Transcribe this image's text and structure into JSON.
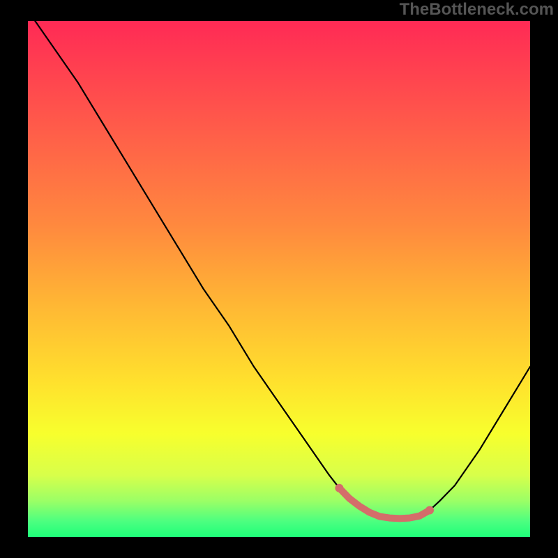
{
  "watermark": "TheBottleneck.com",
  "chart_data": {
    "type": "line",
    "title": "",
    "xlabel": "",
    "ylabel": "",
    "xlim": [
      0,
      100
    ],
    "ylim": [
      0,
      100
    ],
    "series": [
      {
        "name": "bottleneck-curve",
        "x": [
          0,
          5,
          10,
          15,
          20,
          25,
          30,
          35,
          40,
          45,
          50,
          55,
          60,
          62,
          64,
          66,
          68,
          70,
          72,
          74,
          76,
          78,
          80,
          82,
          85,
          90,
          95,
          100
        ],
        "values": [
          102,
          95,
          88,
          80,
          72,
          64,
          56,
          48,
          41,
          33,
          26,
          19,
          12,
          9.5,
          7.5,
          6,
          4.8,
          4,
          3.7,
          3.6,
          3.7,
          4.1,
          5.2,
          7,
          10,
          17,
          25,
          33
        ]
      }
    ],
    "highlight": {
      "name": "valley-segment",
      "color": "#d46d6a",
      "x": [
        62,
        64,
        66,
        68,
        70,
        72,
        74,
        76,
        78,
        80
      ],
      "values": [
        9.5,
        7.5,
        6,
        4.8,
        4,
        3.7,
        3.6,
        3.7,
        4.1,
        5.2
      ]
    },
    "gradient_stops": [
      {
        "offset": 0.0,
        "color": "#ff2a55"
      },
      {
        "offset": 0.2,
        "color": "#ff5a4a"
      },
      {
        "offset": 0.4,
        "color": "#ff8a3e"
      },
      {
        "offset": 0.55,
        "color": "#ffb734"
      },
      {
        "offset": 0.7,
        "color": "#ffe12d"
      },
      {
        "offset": 0.8,
        "color": "#f7ff2d"
      },
      {
        "offset": 0.88,
        "color": "#d8ff4a"
      },
      {
        "offset": 0.93,
        "color": "#9bff66"
      },
      {
        "offset": 0.97,
        "color": "#4bff80"
      },
      {
        "offset": 1.0,
        "color": "#1eff79"
      }
    ]
  }
}
